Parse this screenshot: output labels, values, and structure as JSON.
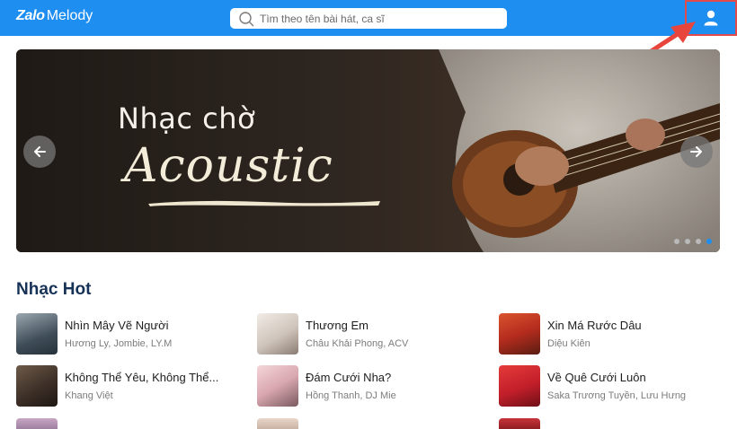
{
  "header": {
    "logo_brand": "Zalo",
    "logo_product": "Melody",
    "search_placeholder": "Tìm theo tên bài hát, ca sĩ",
    "user_icon": "user-icon",
    "accent_color": "#1e8ff0",
    "highlight_color": "#e14b4b"
  },
  "banner": {
    "line1": "Nhạc chờ",
    "line2": "Acoustic",
    "prev_icon": "chevron-left-icon",
    "next_icon": "chevron-right-icon",
    "slide_count": 4,
    "active_slide": 4
  },
  "section": {
    "title": "Nhạc Hot",
    "songs": [
      {
        "title": "Nhìn Mây Vẽ Người",
        "artist": "Hương Ly, Jombie, LY.M"
      },
      {
        "title": "Thương Em",
        "artist": "Châu Khải Phong, ACV"
      },
      {
        "title": "Xin Má Rước Dâu",
        "artist": "Diệu Kiên"
      },
      {
        "title": "Không Thể Yêu, Không Thể...",
        "artist": "Khang Việt"
      },
      {
        "title": "Đám Cưới Nha?",
        "artist": "Hồng Thanh, DJ Mie"
      },
      {
        "title": "Về Quê Cưới Luôn",
        "artist": "Saka Trương Tuyền, Lưu Hưng"
      }
    ]
  }
}
